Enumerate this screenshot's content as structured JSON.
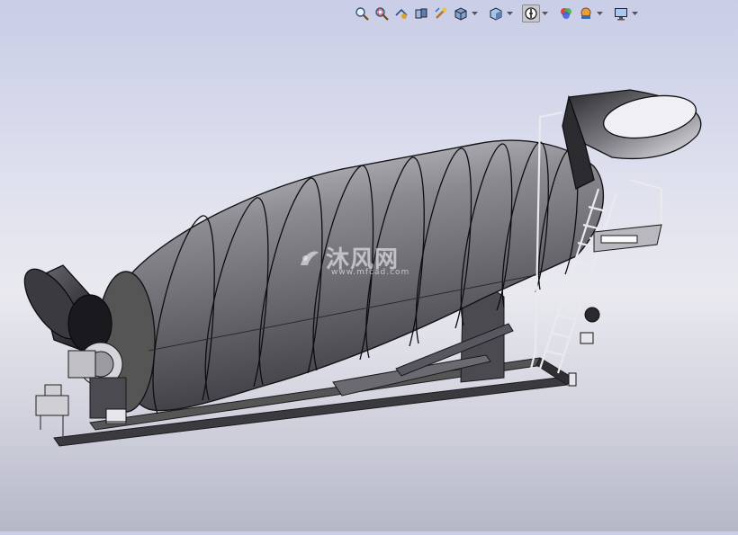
{
  "toolbar": {
    "buttons": [
      {
        "icon": "zoom-to-fit-icon",
        "active": false
      },
      {
        "icon": "zoom-to-area-icon",
        "active": false
      },
      {
        "icon": "previous-view-icon",
        "active": false
      },
      {
        "icon": "section-view-icon",
        "active": false
      },
      {
        "icon": "dynamic-annotation-icon",
        "active": false
      },
      {
        "icon": "view-orientation-icon",
        "active": false
      },
      {
        "icon": "display-style-icon",
        "active": false
      },
      {
        "icon": "hide-show-items-icon",
        "active": true
      },
      {
        "icon": "edit-appearance-icon",
        "active": false
      },
      {
        "icon": "apply-scene-icon",
        "active": false
      },
      {
        "icon": "view-settings-icon",
        "active": false
      }
    ]
  },
  "watermark": {
    "text": "沐风网",
    "url": "www.mfcad.com"
  },
  "colors": {
    "background_top": "#c9cde6",
    "background_bottom": "#b6b7c7",
    "model_body": "#6e6e74",
    "model_edge": "#1a1a1a"
  }
}
